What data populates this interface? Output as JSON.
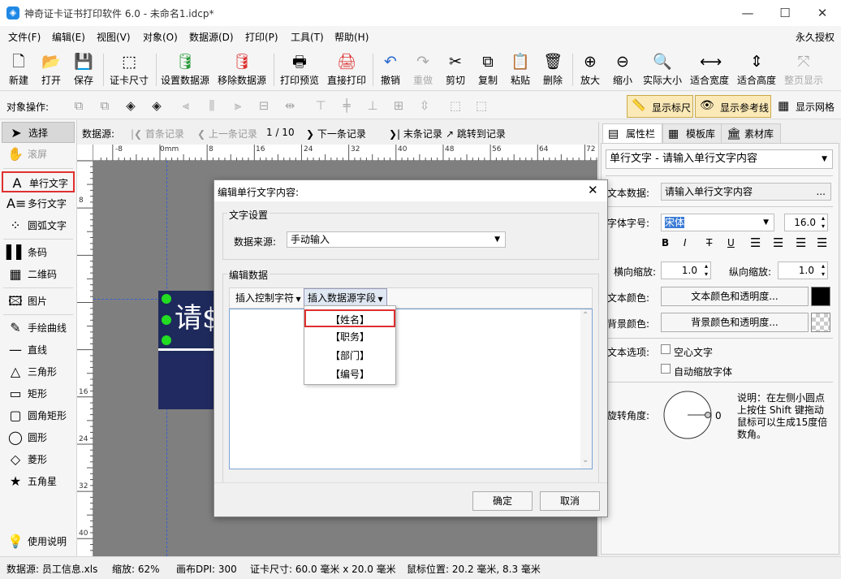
{
  "window": {
    "title": "神奇证卡证书打印软件 6.0 - 未命名1.idcp*",
    "app_icon": "app-logo-icon",
    "controls": [
      "minimize-icon",
      "maximize-icon",
      "close-icon"
    ]
  },
  "menu": [
    "文件(F)",
    "编辑(E)",
    "视图(V)",
    "对象(O)",
    "数据源(D)",
    "打印(P)",
    "工具(T)",
    "帮助(H)"
  ],
  "license": "永久授权",
  "toolbar": [
    {
      "label": "新建",
      "icon": "new-file-icon",
      "glyph": "🗋"
    },
    {
      "label": "打开",
      "icon": "open-icon",
      "glyph": "📂"
    },
    {
      "label": "保存",
      "icon": "save-icon",
      "glyph": "💾"
    },
    {
      "label": "证卡尺寸",
      "icon": "card-size-icon",
      "glyph": "⬚"
    },
    {
      "label": "设置数据源",
      "icon": "set-datasource-icon",
      "glyph": "🛢"
    },
    {
      "label": "移除数据源",
      "icon": "remove-datasource-icon",
      "glyph": "🛢"
    },
    {
      "label": "打印预览",
      "icon": "print-preview-icon",
      "glyph": "🖶"
    },
    {
      "label": "直接打印",
      "icon": "print-icon",
      "glyph": "🖨"
    },
    {
      "label": "撤销",
      "icon": "undo-icon",
      "glyph": "↶"
    },
    {
      "label": "重做",
      "icon": "redo-icon",
      "glyph": "↷"
    },
    {
      "label": "剪切",
      "icon": "cut-icon",
      "glyph": "✂"
    },
    {
      "label": "复制",
      "icon": "copy-icon",
      "glyph": "⧉"
    },
    {
      "label": "粘贴",
      "icon": "paste-icon",
      "glyph": "📋"
    },
    {
      "label": "删除",
      "icon": "delete-icon",
      "glyph": "🗑"
    },
    {
      "label": "放大",
      "icon": "zoom-in-icon",
      "glyph": "⊕"
    },
    {
      "label": "缩小",
      "icon": "zoom-out-icon",
      "glyph": "⊖"
    },
    {
      "label": "实际大小",
      "icon": "actual-size-icon",
      "glyph": "🔍"
    },
    {
      "label": "适合宽度",
      "icon": "fit-width-icon",
      "glyph": "⟷"
    },
    {
      "label": "适合高度",
      "icon": "fit-height-icon",
      "glyph": "⇕"
    },
    {
      "label": "整页显示",
      "icon": "fit-page-icon",
      "glyph": "⤧"
    }
  ],
  "object_ops_label": "对象操作:",
  "show_ruler": "显示标尺",
  "show_guides": "显示参考线",
  "show_grid": "显示网格",
  "tools": [
    {
      "label": "选择",
      "icon": "cursor-icon",
      "glyph": "➤"
    },
    {
      "label": "滚屏",
      "icon": "hand-icon",
      "glyph": "✋"
    },
    {
      "label": "单行文字",
      "icon": "single-text-icon",
      "glyph": "A"
    },
    {
      "label": "多行文字",
      "icon": "multi-text-icon",
      "glyph": "A≡"
    },
    {
      "label": "圆弧文字",
      "icon": "arc-text-icon",
      "glyph": "⁘"
    },
    {
      "label": "条码",
      "icon": "barcode-icon",
      "glyph": "▌▌"
    },
    {
      "label": "二维码",
      "icon": "qrcode-icon",
      "glyph": "▦"
    },
    {
      "label": "图片",
      "icon": "image-icon",
      "glyph": "🖾"
    },
    {
      "label": "手绘曲线",
      "icon": "pen-icon",
      "glyph": "✎"
    },
    {
      "label": "直线",
      "icon": "line-icon",
      "glyph": "—"
    },
    {
      "label": "三角形",
      "icon": "triangle-icon",
      "glyph": "△"
    },
    {
      "label": "矩形",
      "icon": "rectangle-icon",
      "glyph": "▭"
    },
    {
      "label": "圆角矩形",
      "icon": "rounded-rect-icon",
      "glyph": "▢"
    },
    {
      "label": "圆形",
      "icon": "circle-icon",
      "glyph": "◯"
    },
    {
      "label": "菱形",
      "icon": "diamond-icon",
      "glyph": "◇"
    },
    {
      "label": "五角星",
      "icon": "star-icon",
      "glyph": "★"
    },
    {
      "label": "使用说明",
      "icon": "lightbulb-icon",
      "glyph": "💡"
    }
  ],
  "nav": {
    "label": "数据源:",
    "first": "首条记录",
    "prev": "上一条记录",
    "page": "1 / 10",
    "next": "下一条记录",
    "last": "末条记录",
    "jump": "跳转到记录"
  },
  "ruler_h": [
    "-8",
    "0mm",
    "8",
    "16",
    "24",
    "32",
    "40",
    "48",
    "56",
    "64",
    "72"
  ],
  "ruler_v": [
    "8",
    "16",
    "24",
    "32",
    "40"
  ],
  "card_text": "请$",
  "panel": {
    "tabs": [
      "属性栏",
      "模板库",
      "素材库"
    ],
    "object_select": "单行文字 - 请输入单行文字内容",
    "text_data_label": "文本数据:",
    "text_data_value": "请输入单行文字内容",
    "more": "...",
    "font_label": "字体字号:",
    "font_value": "宋体",
    "size_value": "16.0",
    "style_buttons": [
      "B",
      "I",
      "T",
      "U"
    ],
    "hscale_label": "横向缩放:",
    "hscale": "1.0",
    "vscale_label": "纵向缩放:",
    "vscale": "1.0",
    "text_color_label": "文本颜色:",
    "text_color_btn": "文本颜色和透明度...",
    "text_color": "#000000",
    "bg_color_label": "背景颜色:",
    "bg_color_btn": "背景颜色和透明度...",
    "text_options_label": "文本选项:",
    "hollow": "空心文字",
    "autoshrink": "自动缩放字体",
    "rotate_label": "旋转角度:",
    "rotate_value": "0",
    "note": "说明：在左侧小圆点上按住 Shift 键拖动鼠标可以生成15度倍数角。"
  },
  "dialog": {
    "title": "编辑单行文字内容:",
    "text_settings": "文字设置",
    "source_label": "数据来源:",
    "source_value": "手动输入",
    "edit_data": "编辑数据",
    "insert_ctrl": "插入控制字符",
    "insert_field": "插入数据源字段",
    "fields": [
      "【姓名】",
      "【职务】",
      "【部门】",
      "【编号】"
    ],
    "ok": "确定",
    "cancel": "取消"
  },
  "status": {
    "datasource": "数据源: 员工信息.xls",
    "zoom": "缩放: 62%",
    "dpi": "画布DPI: 300",
    "cardsize": "证卡尺寸: 60.0 毫米 x 20.0 毫米",
    "mouse": "鼠标位置: 20.2 毫米, 8.3 毫米"
  },
  "colors": {
    "accent": "#e03030",
    "card": "#1e2a5c",
    "handle": "#22dd22"
  }
}
